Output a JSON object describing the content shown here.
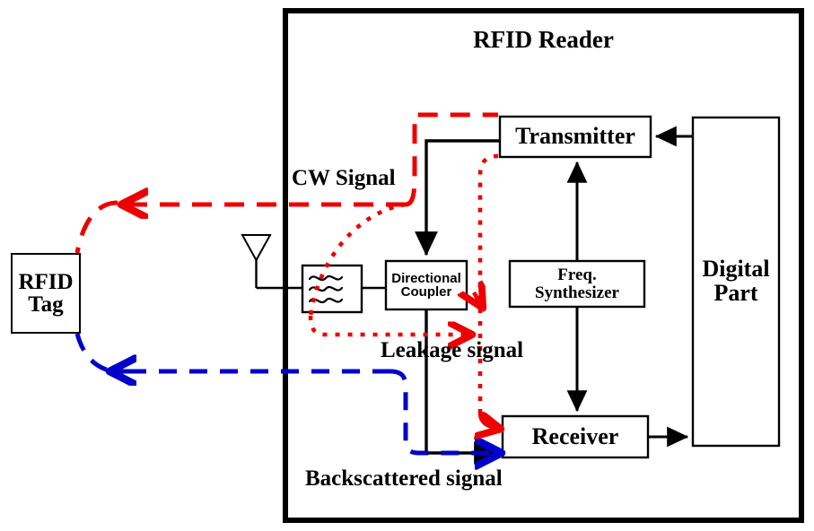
{
  "diagram": {
    "title": "RFID Reader",
    "colors": {
      "outline": "#000000",
      "cw_signal": "#ee0000",
      "leakage_signal": "#ee0000",
      "backscattered_signal": "#0000cc",
      "background": "#ffffff"
    },
    "blocks": [
      {
        "id": "rfid_tag",
        "label": "RFID\nTag",
        "line1": "RFID",
        "line2": "Tag"
      },
      {
        "id": "transmitter",
        "label": "Transmitter",
        "line1": "Transmitter",
        "line2": ""
      },
      {
        "id": "receiver",
        "label": "Receiver",
        "line1": "Receiver",
        "line2": ""
      },
      {
        "id": "freq_synthesizer",
        "label": "Freq. Synthesizer",
        "line1": "Freq.",
        "line2": "Synthesizer"
      },
      {
        "id": "directional_coupler",
        "label": "Directional Coupler",
        "line1": "Directional",
        "line2": "Coupler"
      },
      {
        "id": "digital_part",
        "label": "Digital Part",
        "line1": "Digital",
        "line2": "Part"
      },
      {
        "id": "bandpass_filter",
        "label": "",
        "line1": "",
        "line2": ""
      }
    ],
    "signal_labels": [
      {
        "id": "cw_signal",
        "text": "CW Signal",
        "color": "#000000"
      },
      {
        "id": "leakage_signal",
        "text": "Leakage signal",
        "color": "#000000"
      },
      {
        "id": "backscattered_signal",
        "text": "Backscattered signal",
        "color": "#000000"
      }
    ],
    "icons": [
      {
        "id": "antenna",
        "name": "antenna-icon"
      },
      {
        "id": "filter",
        "name": "bandpass-filter-icon"
      }
    ]
  }
}
